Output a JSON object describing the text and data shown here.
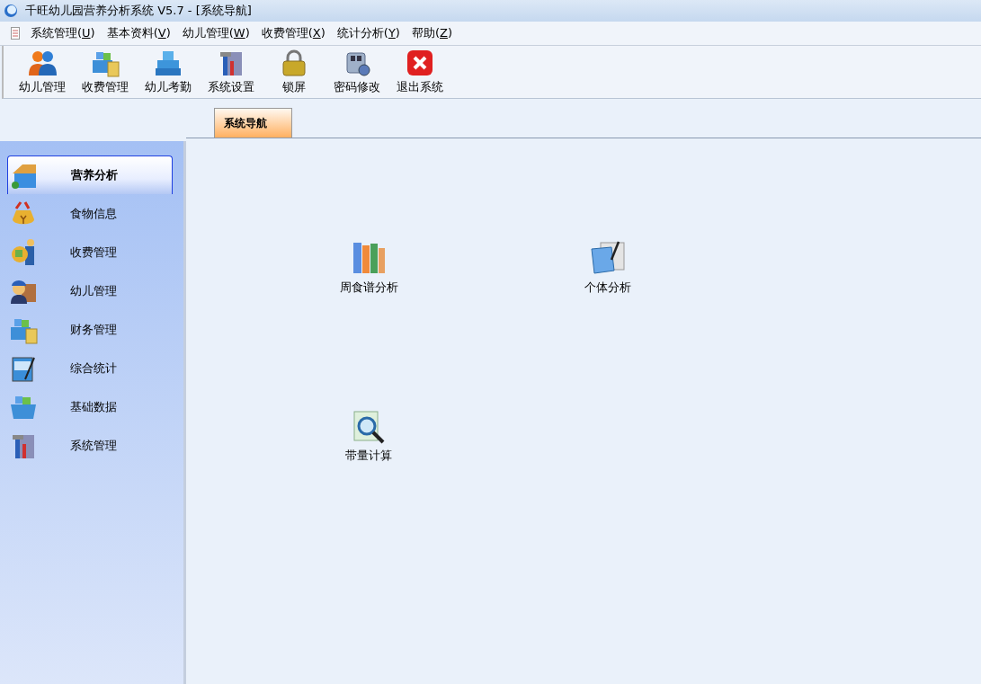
{
  "window": {
    "title": "千旺幼儿园营养分析系统 V5.7 - [系统导航]"
  },
  "menu": [
    "系统管理(U)",
    "基本资料(V)",
    "幼儿管理(W)",
    "收费管理(X)",
    "统计分析(Y)",
    "帮助(Z)"
  ],
  "toolbar": [
    "幼儿管理",
    "收费管理",
    "幼儿考勤",
    "系统设置",
    "锁屏",
    "密码修改",
    "退出系统"
  ],
  "tabs": [
    {
      "label": "系统导航",
      "selected": true
    }
  ],
  "sidebar": {
    "items": [
      {
        "label": "营养分析",
        "selected": true
      },
      {
        "label": "食物信息",
        "selected": false
      },
      {
        "label": "收费管理",
        "selected": false
      },
      {
        "label": "幼儿管理",
        "selected": false
      },
      {
        "label": "财务管理",
        "selected": false
      },
      {
        "label": "综合统计",
        "selected": false
      },
      {
        "label": "基础数据",
        "selected": false
      },
      {
        "label": "系统管理",
        "selected": false
      }
    ]
  },
  "navigation": [
    "周食谱分析",
    "个体分析",
    "带量计算"
  ]
}
